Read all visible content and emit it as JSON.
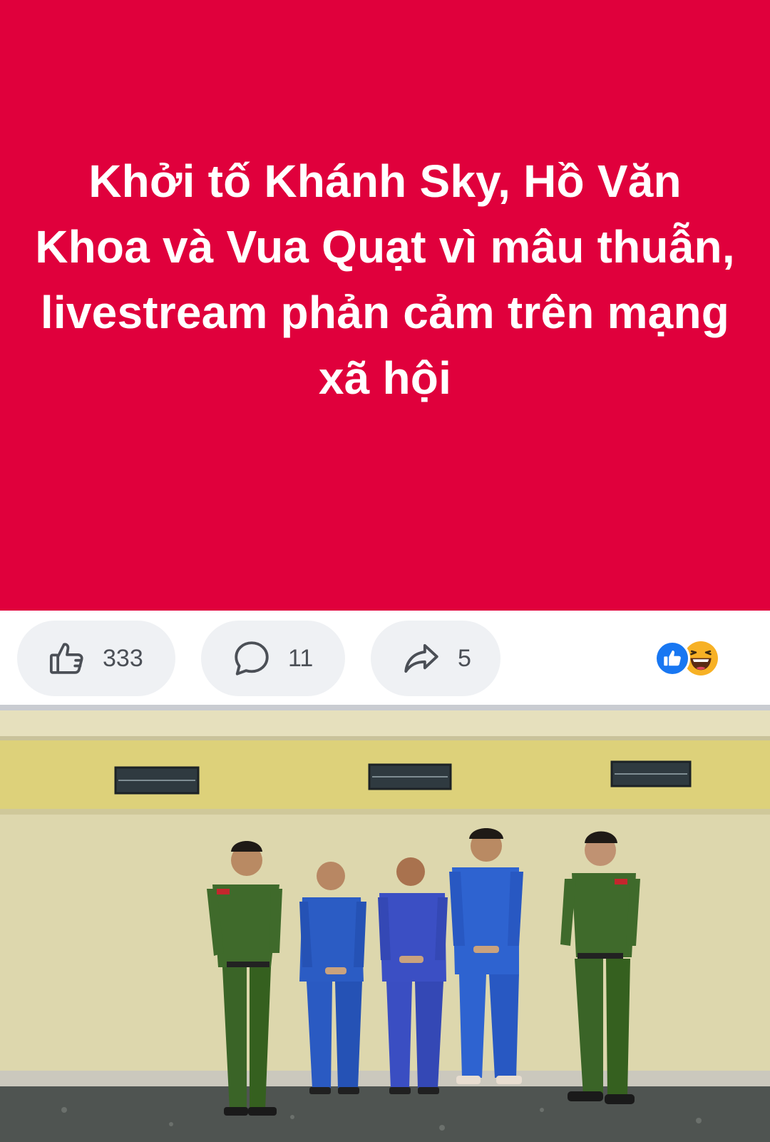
{
  "post": {
    "background": "#e0003c",
    "title_lines": [
      "Khởi tố Khánh Sky, Hồ Văn",
      "Khoa và Vua Quạt vì mâu thuẫn,",
      "livestream phản cảm trên mạng",
      "xã hội"
    ]
  },
  "actions": {
    "like": {
      "icon": "thumbs-up-icon",
      "count": "333"
    },
    "comment": {
      "icon": "comment-bubble-icon",
      "count": "11"
    },
    "share": {
      "icon": "share-arrow-icon",
      "count": "5"
    }
  },
  "reactions": [
    {
      "icon": "like-reaction-icon",
      "color": "#1877f2"
    },
    {
      "icon": "haha-reaction-icon",
      "color": "#f7b125"
    }
  ],
  "photo": {
    "description_icon": "news-photo"
  }
}
